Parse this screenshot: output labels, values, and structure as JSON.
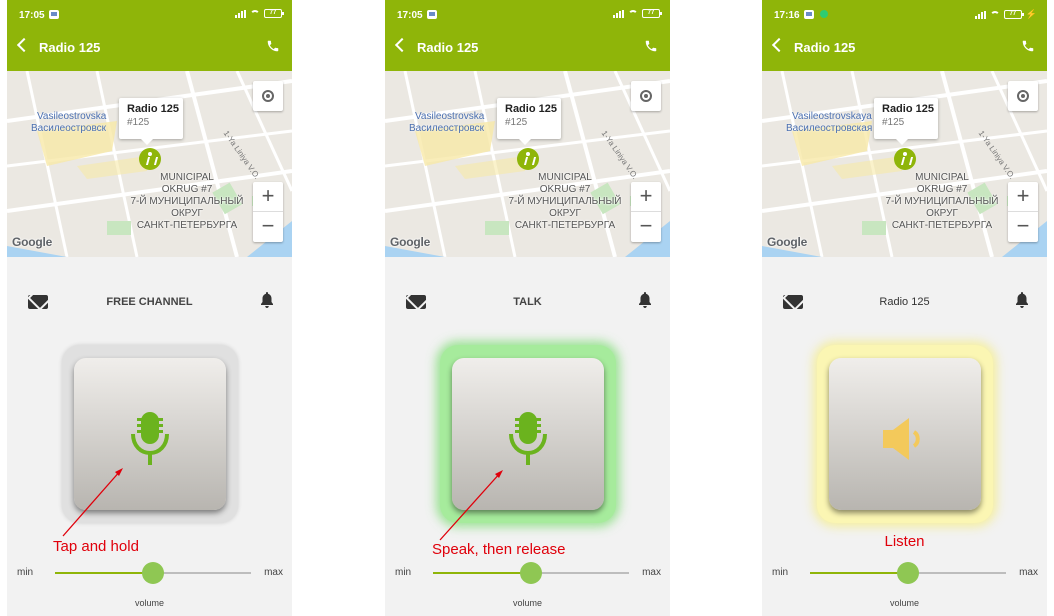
{
  "colors": {
    "accent": "#8fb509",
    "annotation": "#e0000b",
    "talk_glow": "#a6eb9c",
    "listen_glow": "#fbf6b3",
    "mic": "#6bb31e",
    "speaker": "#f3c95b"
  },
  "screens": [
    {
      "status": {
        "time": "17:05",
        "battery": "77"
      },
      "header": {
        "title": "Radio 125"
      },
      "map": {
        "place_en": "Vasileostrovska",
        "place_ru": "Василеостровск",
        "street": "1-Ya Liniya V.O.",
        "district": [
          "MUNICIPAL",
          "OKRUG #7",
          "7-Й МУНИЦИПАЛЬНЫЙ",
          "ОКРУГ",
          "САНКТ-ПЕТЕРБУРГА"
        ],
        "info_title": "Radio 125",
        "info_subtitle": "#125",
        "zoom_in": "+",
        "zoom_out": "−",
        "logo": "Google"
      },
      "channel_label": "FREE CHANNEL",
      "button_state": "idle",
      "button_icon": "microphone-icon",
      "annotation": "Tap and hold",
      "volume": {
        "min_label": "min",
        "max_label": "max",
        "caption": "volume",
        "level": 0.5
      }
    },
    {
      "status": {
        "time": "17:05",
        "battery": "77"
      },
      "header": {
        "title": "Radio 125"
      },
      "map": {
        "place_en": "Vasileostrovska",
        "place_ru": "Василеостровск",
        "street": "1-Ya Liniya V.O.",
        "district": [
          "MUNICIPAL",
          "OKRUG #7",
          "7-Й МУНИЦИПАЛЬНЫЙ",
          "ОКРУГ",
          "САНКТ-ПЕТЕРБУРГА"
        ],
        "info_title": "Radio 125",
        "info_subtitle": "#125",
        "zoom_in": "+",
        "zoom_out": "−",
        "logo": "Google"
      },
      "channel_label": "TALK",
      "button_state": "talk",
      "button_icon": "microphone-icon",
      "annotation": "Speak, then release",
      "volume": {
        "min_label": "min",
        "max_label": "max",
        "caption": "volume",
        "level": 0.5
      }
    },
    {
      "status": {
        "time": "17:16",
        "battery": "77"
      },
      "header": {
        "title": "Radio 125"
      },
      "map": {
        "place_en": "Vasileostrovskaya",
        "place_ru": "Василеостровская",
        "street": "1-Ya Liniya V.O.",
        "district": [
          "MUNICIPAL",
          "OKRUG #7",
          "7-Й МУНИЦИПАЛЬНЫЙ",
          "ОКРУГ",
          "САНКТ-ПЕТЕРБУРГА"
        ],
        "info_title": "Radio 125",
        "info_subtitle": "#125",
        "zoom_in": "+",
        "zoom_out": "−",
        "logo": "Google"
      },
      "channel_label": "Radio 125",
      "button_state": "listen",
      "button_icon": "speaker-icon",
      "annotation": "Listen",
      "volume": {
        "min_label": "min",
        "max_label": "max",
        "caption": "volume",
        "level": 0.5
      }
    }
  ]
}
